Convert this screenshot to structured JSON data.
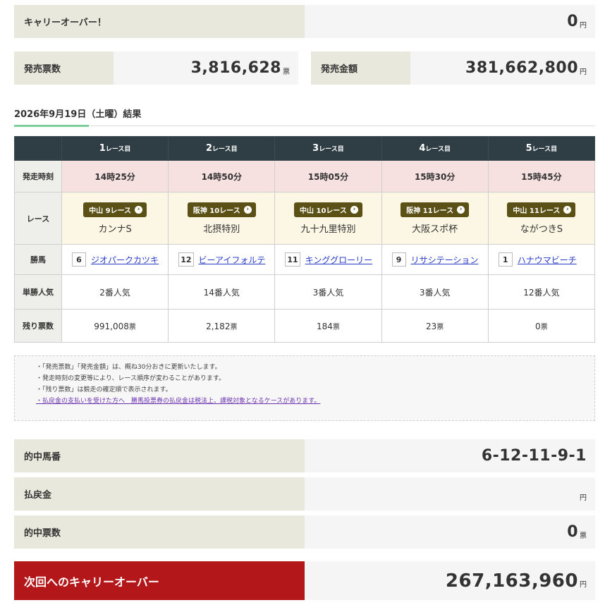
{
  "carryover": {
    "label": "キャリーオーバー！",
    "value": "0",
    "unit": "円"
  },
  "sales": {
    "tickets_label": "発売票数",
    "tickets_value": "3,816,628",
    "tickets_unit": "票",
    "amount_label": "発売金額",
    "amount_value": "381,662,800",
    "amount_unit": "円"
  },
  "result_header": "2026年9月19日（土曜）結果",
  "table": {
    "headers": [
      {
        "num": "1",
        "suffix": "レース目"
      },
      {
        "num": "2",
        "suffix": "レース目"
      },
      {
        "num": "3",
        "suffix": "レース目"
      },
      {
        "num": "4",
        "suffix": "レース目"
      },
      {
        "num": "5",
        "suffix": "レース目"
      }
    ],
    "row_labels": {
      "time": "発走時刻",
      "race": "レース",
      "winner": "勝馬",
      "popularity": "単勝人気",
      "remaining": "残り票数"
    },
    "times": [
      "14時25分",
      "14時50分",
      "15時05分",
      "15時30分",
      "15時45分"
    ],
    "venues": [
      "中山 9レース",
      "阪神 10レース",
      "中山 10レース",
      "阪神 11レース",
      "中山 11レース"
    ],
    "race_names": [
      "カンナS",
      "北摂特別",
      "九十九里特別",
      "大阪スポ杯",
      "ながつきS"
    ],
    "winner_numbers": [
      "6",
      "12",
      "11",
      "9",
      "1"
    ],
    "winner_names": [
      "ジオパークカツキ",
      "ビーアイフォルテ",
      "キンググローリー",
      "リサシテーション",
      "ハナウマビーチ"
    ],
    "popularity": [
      "2番人気",
      "14番人気",
      "3番人気",
      "3番人気",
      "12番人気"
    ],
    "remaining": [
      "991,008",
      "2,182",
      "184",
      "23",
      "0"
    ],
    "remaining_unit": "票"
  },
  "notes": [
    "・「発売票数」「発売金額」は、概ね30分おきに更新いたします。",
    "・発走時刻の変更等により、レース順序が変わることがあります。",
    "・「残り票数」は競走の確定順で表示されます。",
    "・払戻金の支払いを受けた方へ　勝馬投票券の払戻金は税法上、課税対象となるケースがあります。"
  ],
  "results": {
    "winning_label": "的中馬番",
    "winning_value": "6-12-11-9-1",
    "payout_label": "払戻金",
    "payout_value": "",
    "payout_unit": "円",
    "hits_label": "的中票数",
    "hits_value": "0",
    "hits_unit": "票"
  },
  "next_carryover": {
    "label": "次回へのキャリーオーバー",
    "value": "267,163,960",
    "unit": "円"
  },
  "colors": {
    "label_bg": "#e9e8dc",
    "header_bg": "#2f3e45",
    "carry_red": "#b3171a",
    "pill": "#5b5016"
  }
}
